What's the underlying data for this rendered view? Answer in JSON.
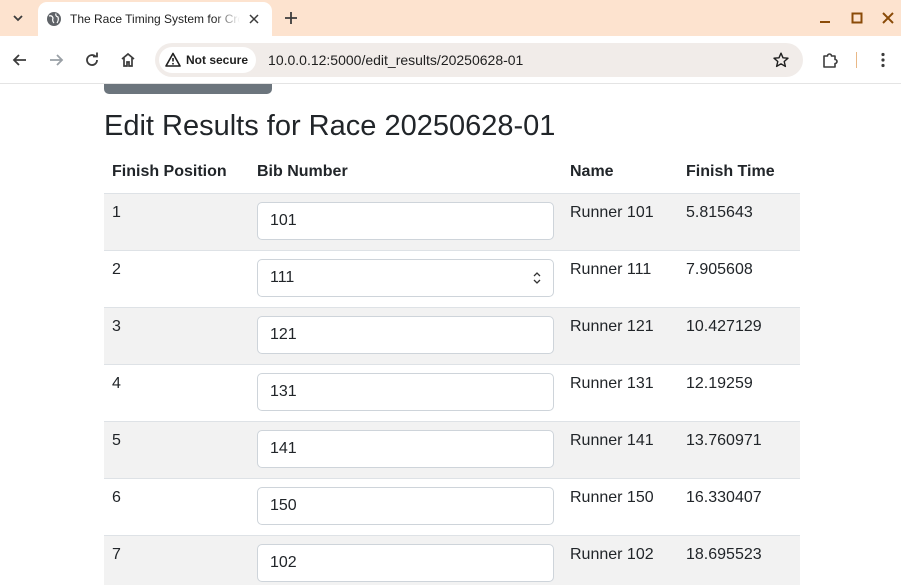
{
  "browser": {
    "tab_title": "The Race Timing System for Cross Country",
    "security_label": "Not secure",
    "url": "10.0.0.12:5000/edit_results/20250628-01"
  },
  "page": {
    "title": "Edit Results for Race 20250628-01"
  },
  "table": {
    "headers": [
      "Finish Position",
      "Bib Number",
      "Name",
      "Finish Time"
    ],
    "rows": [
      {
        "position": "1",
        "bib": "101",
        "name": "Runner 101",
        "time": "5.815643"
      },
      {
        "position": "2",
        "bib": "111",
        "name": "Runner 111",
        "time": "7.905608"
      },
      {
        "position": "3",
        "bib": "121",
        "name": "Runner 121",
        "time": "10.427129"
      },
      {
        "position": "4",
        "bib": "131",
        "name": "Runner 131",
        "time": "12.19259"
      },
      {
        "position": "5",
        "bib": "141",
        "name": "Runner 141",
        "time": "13.760971"
      },
      {
        "position": "6",
        "bib": "150",
        "name": "Runner 150",
        "time": "16.330407"
      },
      {
        "position": "7",
        "bib": "102",
        "name": "Runner 102",
        "time": "18.695523"
      }
    ]
  },
  "colors": {
    "tabstrip": "#fde3cf",
    "row_stripe": "#f2f2f2",
    "button_gray": "#6c757d"
  }
}
